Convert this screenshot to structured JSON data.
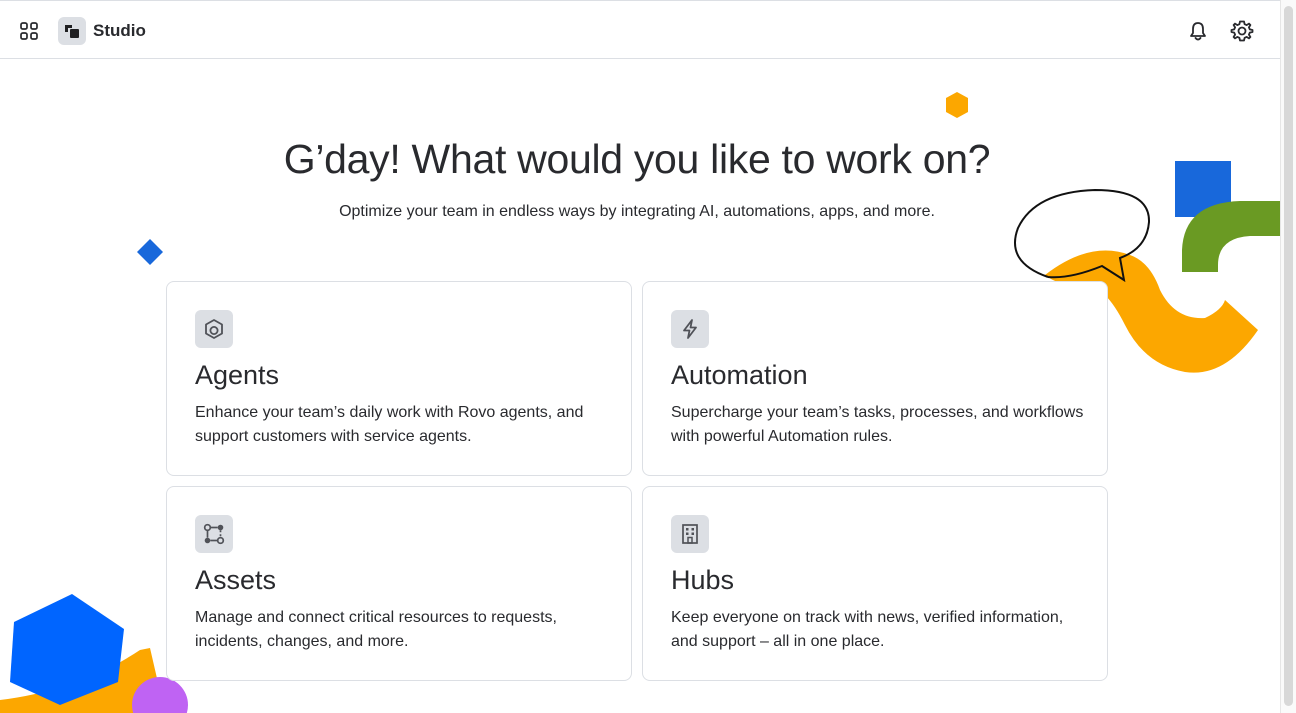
{
  "header": {
    "app_name": "Studio",
    "icons": {
      "app_switcher": "app-switcher-icon",
      "logo": "studio-logo-icon",
      "notifications": "bell-icon",
      "settings": "gear-icon"
    }
  },
  "hero": {
    "title": "G’day! What would you like to work on?",
    "subtitle": "Optimize your team in endless ways by integrating AI, automations, apps, and more."
  },
  "cards": [
    {
      "title": "Agents",
      "description": "Enhance your team’s daily work with Rovo agents, and support customers with service agents.",
      "icon": "agent-icon"
    },
    {
      "title": "Automation",
      "description": "Supercharge your team’s tasks, processes, and workflows with powerful Automation rules.",
      "icon": "lightning-icon"
    },
    {
      "title": "Assets",
      "description": "Manage and connect critical resources to requests, incidents, changes, and more.",
      "icon": "assets-icon"
    },
    {
      "title": "Hubs",
      "description": "Keep everyone on track with news, verified information, and support – all in one place.",
      "icon": "building-icon"
    }
  ],
  "colors": {
    "text": "#292a2e",
    "border": "#dcdfe4",
    "decor_orange": "#ffa500",
    "decor_blue": "#1868db",
    "decor_bright_blue": "#0065ff",
    "decor_green": "#6a9a23",
    "decor_purple": "#bf63f3"
  }
}
